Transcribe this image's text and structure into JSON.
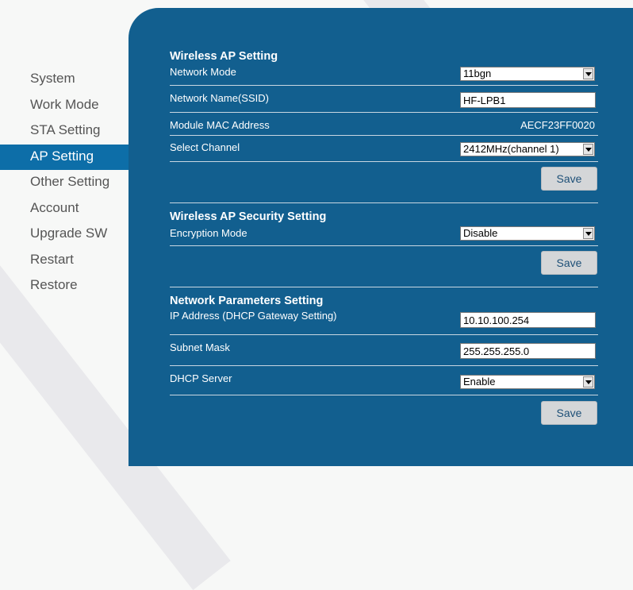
{
  "nav": {
    "items": [
      {
        "label": "System"
      },
      {
        "label": "Work Mode"
      },
      {
        "label": "STA Setting"
      },
      {
        "label": "AP Setting"
      },
      {
        "label": "Other Setting"
      },
      {
        "label": "Account"
      },
      {
        "label": "Upgrade SW"
      },
      {
        "label": "Restart"
      },
      {
        "label": "Restore"
      }
    ],
    "active": "AP Setting"
  },
  "wireless_ap": {
    "title": "Wireless AP Setting",
    "network_mode_label": "Network Mode",
    "network_mode_value": "11bgn",
    "ssid_label": "Network Name(SSID)",
    "ssid_value": "HF-LPB1",
    "mac_label": "Module MAC Address",
    "mac_value": "AECF23FF0020",
    "channel_label": "Select Channel",
    "channel_value": "2412MHz(channel 1)",
    "save_label": "Save"
  },
  "security": {
    "title": "Wireless AP Security Setting",
    "encryption_label": "Encryption Mode",
    "encryption_value": "Disable",
    "save_label": "Save"
  },
  "network": {
    "title": "Network Parameters Setting",
    "ip_label": "IP Address (DHCP Gateway Setting)",
    "ip_value": "10.10.100.254",
    "mask_label": "Subnet Mask",
    "mask_value": "255.255.255.0",
    "dhcp_label": "DHCP Server",
    "dhcp_value": "Enable",
    "save_label": "Save"
  },
  "colors": {
    "panel": "#125f8f",
    "active_nav": "#0d6ea8",
    "button": "#d4d6d8"
  }
}
